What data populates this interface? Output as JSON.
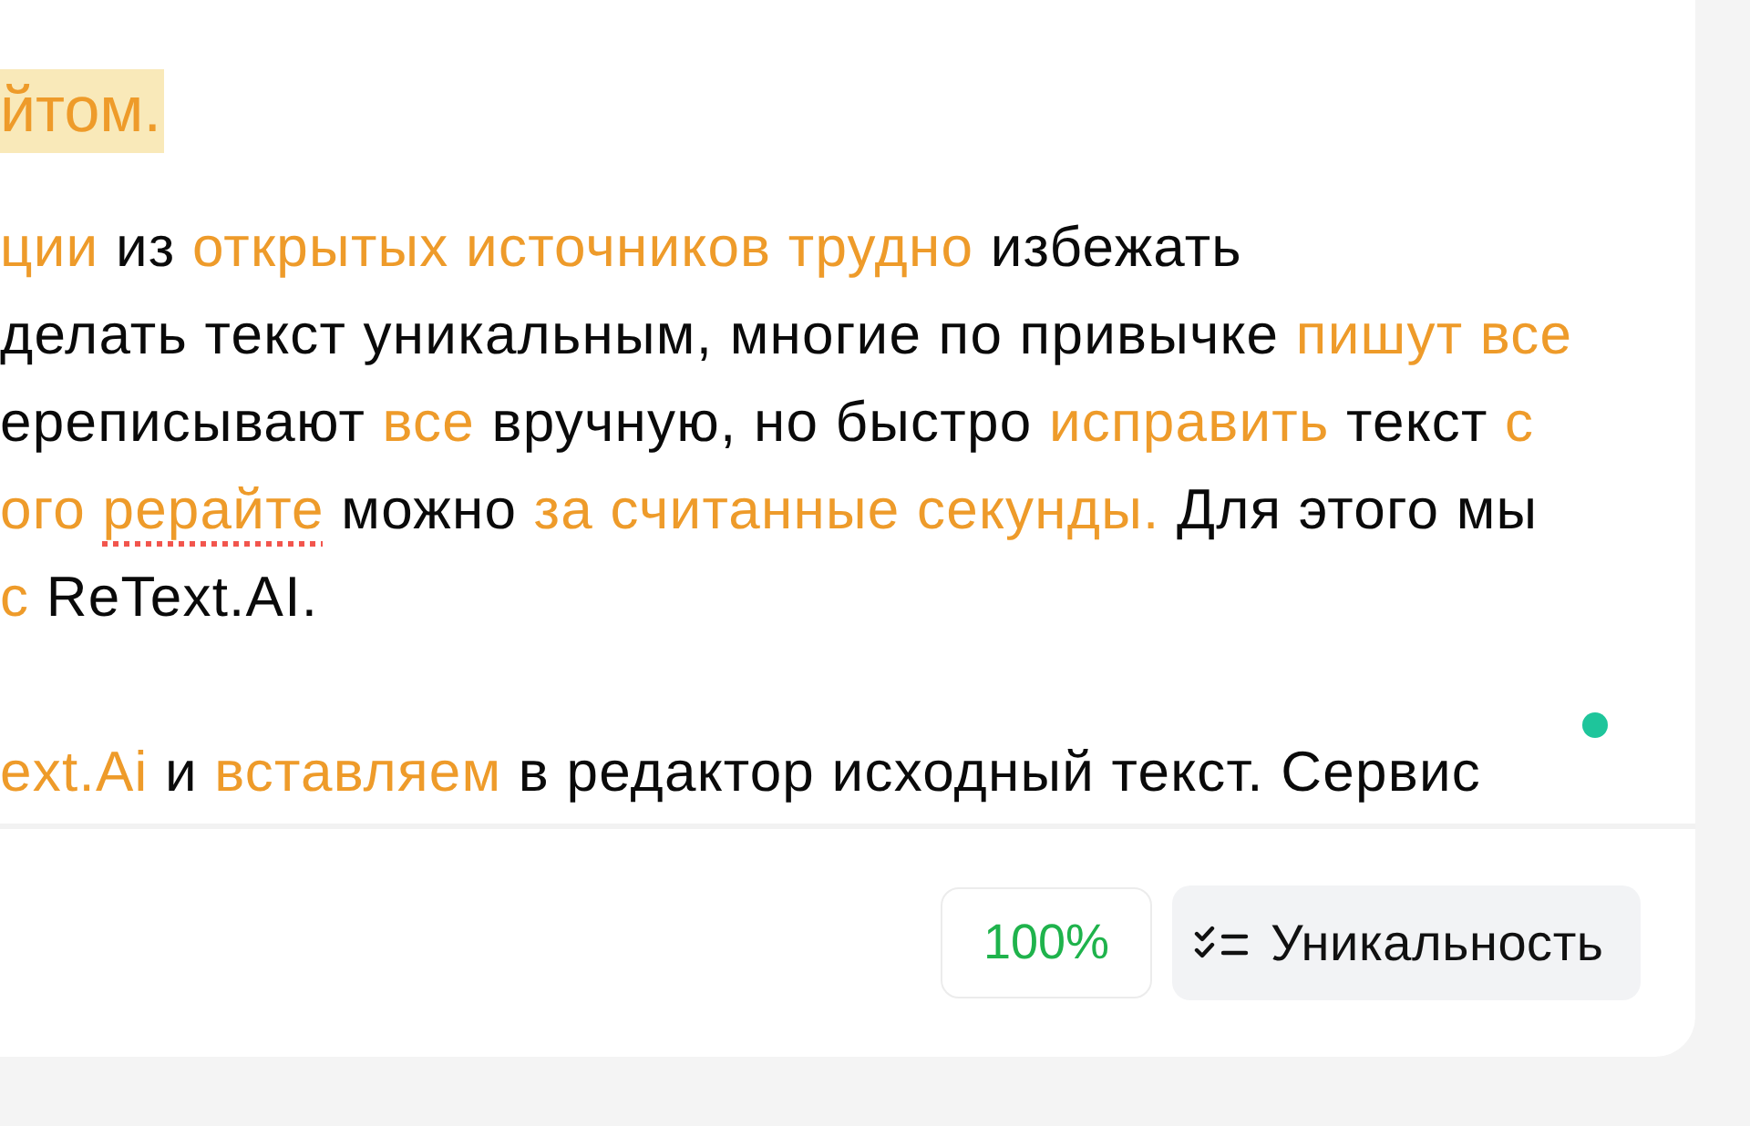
{
  "editor": {
    "heading": {
      "text": "йтом.",
      "changed": true,
      "highlighted": true
    },
    "paragraphs": [
      {
        "lines": [
          [
            {
              "text": "ции",
              "changed": true,
              "misspelled": false
            },
            {
              "text": " из ",
              "changed": false,
              "misspelled": false
            },
            {
              "text": "открытых источников трудно",
              "changed": true,
              "misspelled": false
            },
            {
              "text": " избежать",
              "changed": false,
              "misspelled": false
            }
          ],
          [
            {
              "text": "делать текст уникальным, многие по привычке ",
              "changed": false,
              "misspelled": false
            },
            {
              "text": "пишут все",
              "changed": true,
              "misspelled": false
            }
          ],
          [
            {
              "text": "ереписывают ",
              "changed": false,
              "misspelled": false
            },
            {
              "text": "все",
              "changed": true,
              "misspelled": false
            },
            {
              "text": " вручную, но быстро ",
              "changed": false,
              "misspelled": false
            },
            {
              "text": "исправить",
              "changed": true,
              "misspelled": false
            },
            {
              "text": " текст ",
              "changed": false,
              "misspelled": false
            },
            {
              "text": "с",
              "changed": true,
              "misspelled": false
            }
          ],
          [
            {
              "text": "ого ",
              "changed": true,
              "misspelled": false
            },
            {
              "text": "рерайте",
              "changed": true,
              "misspelled": true
            },
            {
              "text": " можно ",
              "changed": false,
              "misspelled": false
            },
            {
              "text": "за считанные секунды.",
              "changed": true,
              "misspelled": false
            },
            {
              "text": " Для этого мы",
              "changed": false,
              "misspelled": false
            }
          ],
          [
            {
              "text": "с",
              "changed": true,
              "misspelled": false
            },
            {
              "text": " ReText.AI.",
              "changed": false,
              "misspelled": false
            }
          ]
        ]
      },
      {
        "lines": [
          [
            {
              "text": "ext.Ai",
              "changed": true,
              "misspelled": false
            },
            {
              "text": " и ",
              "changed": false,
              "misspelled": false
            },
            {
              "text": "вставляем",
              "changed": true,
              "misspelled": false
            },
            {
              "text": " в редактор исходный текст. Сервис",
              "changed": false,
              "misspelled": false
            }
          ]
        ]
      }
    ]
  },
  "footer": {
    "score": "100%",
    "button": {
      "label": "Уникальность"
    }
  }
}
